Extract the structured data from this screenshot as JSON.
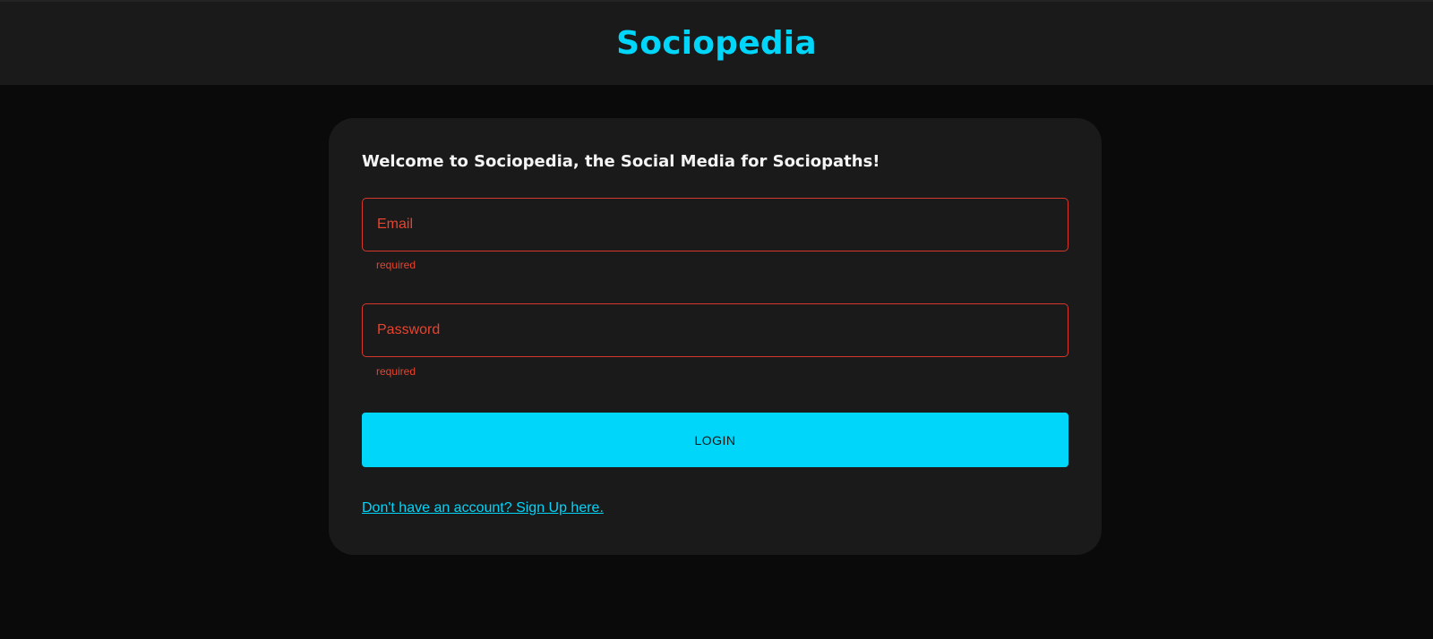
{
  "header": {
    "brand": "Sociopedia",
    "brand_color": "#00d5fa"
  },
  "login_card": {
    "welcome_text": "Welcome to Sociopedia, the Social Media for Sociopaths!",
    "email": {
      "label": "Email",
      "value": "",
      "helper_text": "required"
    },
    "password": {
      "label": "Password",
      "value": "",
      "helper_text": "required"
    },
    "login_button_label": "LOGIN",
    "signup_link_text": "Don't have an account? Sign Up here."
  },
  "colors": {
    "background": "#0a0a0a",
    "surface": "#1a1a1a",
    "accent": "#00d5fa",
    "error": "#e8432f"
  }
}
